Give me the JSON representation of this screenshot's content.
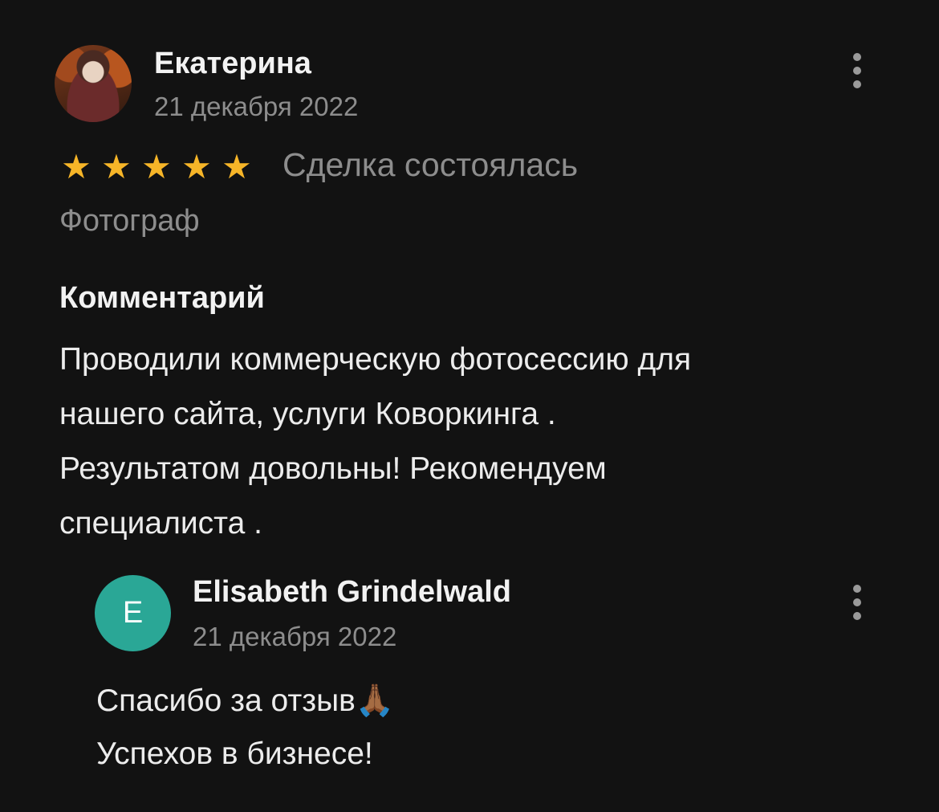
{
  "review": {
    "author": "Екатерина",
    "date": "21 декабря 2022",
    "rating": 5,
    "stars": [
      "★",
      "★",
      "★",
      "★",
      "★"
    ],
    "status": "Сделка состоялась",
    "category": "Фотограф",
    "comment_heading": "Комментарий",
    "comment_lines": [
      "Проводили коммерческую фотосессию для",
      "нашего сайта, услуги Коворкинга .",
      "Результатом довольны! Рекомендуем",
      "специалиста ."
    ],
    "menu_icon": "more-vertical-icon"
  },
  "reply": {
    "avatar_letter": "E",
    "avatar_color": "#2aa796",
    "author": "Elisabeth Grindelwald",
    "date": "21 декабря 2022",
    "lines": [
      "Спасибо за отзыв🙏🏾",
      "Успехов в бизнесе!"
    ],
    "menu_icon": "more-vertical-icon"
  },
  "colors": {
    "background": "#121212",
    "star": "#f6b528",
    "muted_text": "#8d8d8d"
  }
}
